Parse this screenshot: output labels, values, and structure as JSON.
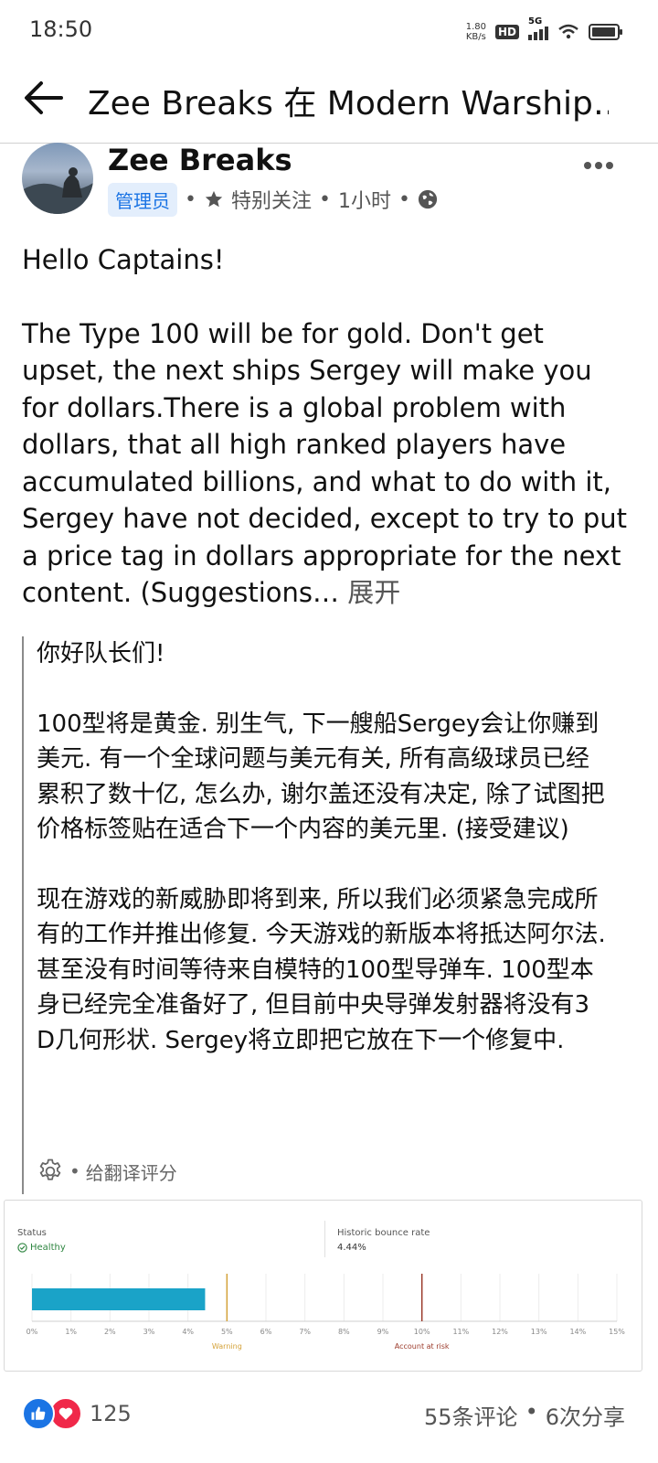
{
  "status_bar": {
    "time": "18:50",
    "net_speed_value": "1.80",
    "net_speed_unit": "KB/s",
    "hd": "HD",
    "network": "5G"
  },
  "top_bar": {
    "title": "Zee Breaks 在 Modern Warship…"
  },
  "post": {
    "author": "Zee Breaks",
    "admin_badge": "管理员",
    "dot": "•",
    "star_label": "特别关注",
    "time": "1小时",
    "body_p1": "Hello Captains!",
    "body_p2": "The Type 100 will be for gold. Don't get upset, the next ships Sergey will make you for dollars.There is a global problem with dollars,  that all high ranked players have accumulated billions, and what to do with it, Sergey have not decided, except to try to put a price tag in dollars appropriate for the next content. (Suggestions…",
    "expand": "展开"
  },
  "translation": {
    "p1": "你好队长们!",
    "p2": "100型将是黄金. 别生气, 下一艘船Sergey会让你赚到美元. 有一个全球问题与美元有关, 所有高级球员已经累积了数十亿, 怎么办, 谢尔盖还没有决定, 除了试图把价格标签贴在适合下一个内容的美元里. (接受建议)",
    "p3": "现在游戏的新威胁即将到来, 所以我们必须紧急完成所有的工作并推出修复. 今天游戏的新版本将抵达阿尔法. 甚至没有时间等待来自模特的100型导弹车. 100型本身已经完全准备好了, 但目前中央导弹发射器将没有3 D几何形状. Sergey将立即把它放在下一个修复中.",
    "rate_label": "给翻译评分"
  },
  "screenshot": {
    "status_label": "Status",
    "status_value": "Healthy",
    "historic_label": "Historic bounce rate",
    "historic_value": "4.44%",
    "colors": {
      "bar": "#1aa3c8",
      "warning": "#d4a23a",
      "risk": "#9b3a2a",
      "healthy": "#2e8540"
    }
  },
  "chart_data": {
    "type": "bar",
    "orientation": "horizontal",
    "values": [
      4.44
    ],
    "xlim": [
      0,
      15
    ],
    "x_ticks": [
      "0%",
      "1%",
      "2%",
      "3%",
      "4%",
      "5%",
      "6%",
      "7%",
      "8%",
      "9%",
      "10%",
      "11%",
      "12%",
      "13%",
      "14%",
      "15%"
    ],
    "thresholds": [
      {
        "value": 5,
        "label": "Warning"
      },
      {
        "value": 10,
        "label": "Account at risk"
      }
    ],
    "grid": true
  },
  "footer": {
    "reaction_count": "125",
    "comments": "55条评论",
    "separator": "•",
    "shares": "6次分享"
  },
  "icons": {
    "back": "arrow-left-icon",
    "more": "more-horizontal-icon",
    "star": "star-icon",
    "globe": "globe-icon",
    "gear": "gear-icon",
    "like": "like-icon",
    "love": "love-icon"
  }
}
